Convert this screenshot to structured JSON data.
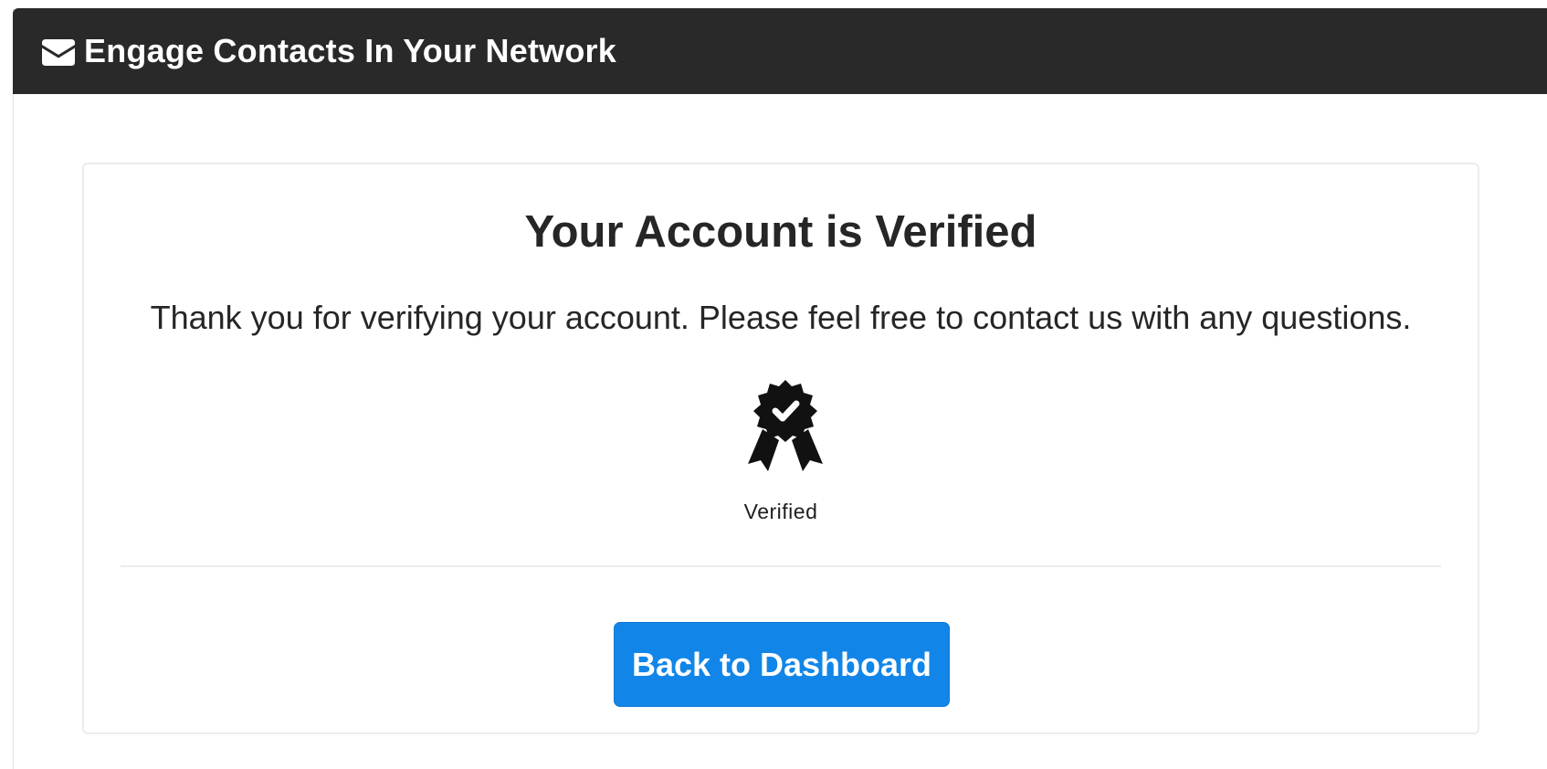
{
  "header": {
    "icon": "envelope-icon",
    "title": "Engage Contacts In Your Network"
  },
  "card": {
    "title": "Your Account is Verified",
    "message": "Thank you for verifying your account. Please feel free to contact us with any questions.",
    "badge": {
      "icon": "verified-badge-icon",
      "caption": "Verified"
    },
    "button_label": "Back to Dashboard"
  },
  "colors": {
    "header_background": "#292929",
    "button_background": "#1186e8",
    "text": "#262626"
  }
}
